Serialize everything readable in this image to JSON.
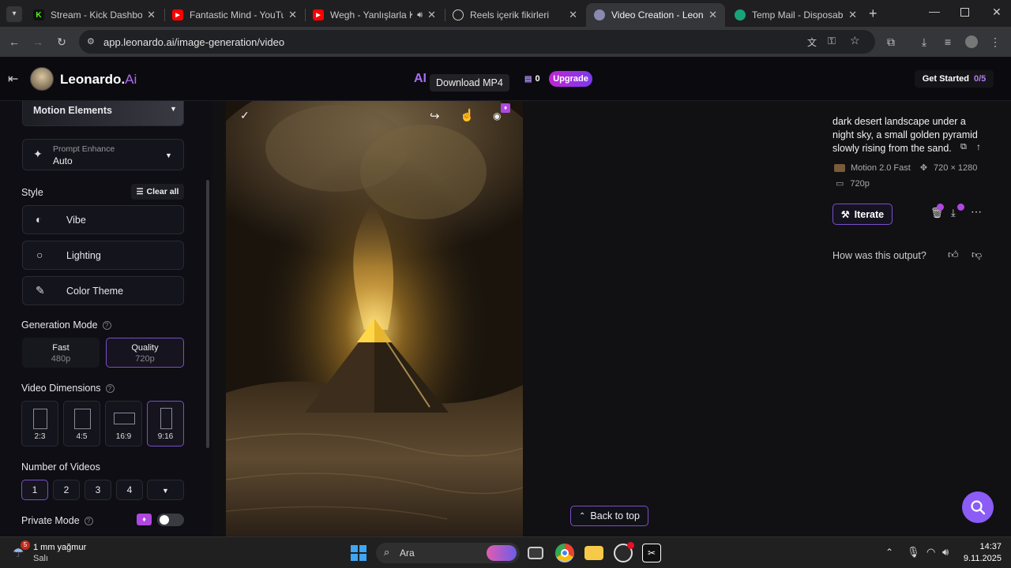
{
  "browser": {
    "tabs": [
      {
        "title": "Stream - Kick Dashboard",
        "favicon": "kick-icon"
      },
      {
        "title": "Fantastic Mind - YouTube",
        "favicon": "youtube-icon"
      },
      {
        "title": "Wegh - Yanlışlarla Karşı",
        "favicon": "youtube-icon"
      },
      {
        "title": "Reels içerik fikirleri",
        "favicon": "chatgpt-icon"
      },
      {
        "title": "Video Creation - Leonardo",
        "favicon": "leonardo-icon"
      },
      {
        "title": "Temp Mail - Disposable Te",
        "favicon": "tempmail-icon"
      }
    ],
    "url": "app.leonardo.ai/image-generation/video"
  },
  "header": {
    "logo_text": "Leonardo.",
    "logo_accent": "Ai",
    "center_text": "AI",
    "tooltip": "Download MP4",
    "token_count": "0",
    "upgrade_label": "Upgrade",
    "get_started_label": "Get Started",
    "get_started_progress": "0/5"
  },
  "sidebar": {
    "motion_elements_label": "Motion Elements",
    "prompt_enhance_label": "Prompt Enhance",
    "prompt_enhance_value": "Auto",
    "style_heading": "Style",
    "clear_all_label": "Clear all",
    "style_options": [
      "Vibe",
      "Lighting",
      "Color Theme"
    ],
    "generation_mode_heading": "Generation Mode",
    "modes": [
      {
        "name": "Fast",
        "res": "480p",
        "selected": false
      },
      {
        "name": "Quality",
        "res": "720p",
        "selected": true
      }
    ],
    "video_dimensions_heading": "Video Dimensions",
    "dimensions": [
      "2:3",
      "4:5",
      "16:9",
      "9:16"
    ],
    "selected_dimension": "9:16",
    "number_of_videos_heading": "Number of Videos",
    "video_counts": [
      "1",
      "2",
      "3",
      "4"
    ],
    "selected_count": "1",
    "private_mode_label": "Private Mode",
    "private_mode_on": false
  },
  "main": {
    "back_to_top_label": "Back to top"
  },
  "details": {
    "prompt_lines": [
      "dark desert landscape under a",
      "night sky, a small golden pyramid",
      "slowly rising from the sand."
    ],
    "model": "Motion 2.0 Fast",
    "resolution": "720 × 1280",
    "quality": "720p",
    "iterate_label": "Iterate",
    "feedback_question": "How was this output?"
  },
  "taskbar": {
    "weather_temp": "1 mm yağmur",
    "weather_desc": "Salı",
    "weather_badge": "5",
    "search_placeholder": "Ara",
    "time": "14:37",
    "date": "9.11.2025"
  },
  "colors": {
    "accent_purple": "#a855f7",
    "upgrade_gradient_start": "#c026d3",
    "upgrade_gradient_end": "#7c3aed",
    "selected_border": "#7a4fc9"
  }
}
